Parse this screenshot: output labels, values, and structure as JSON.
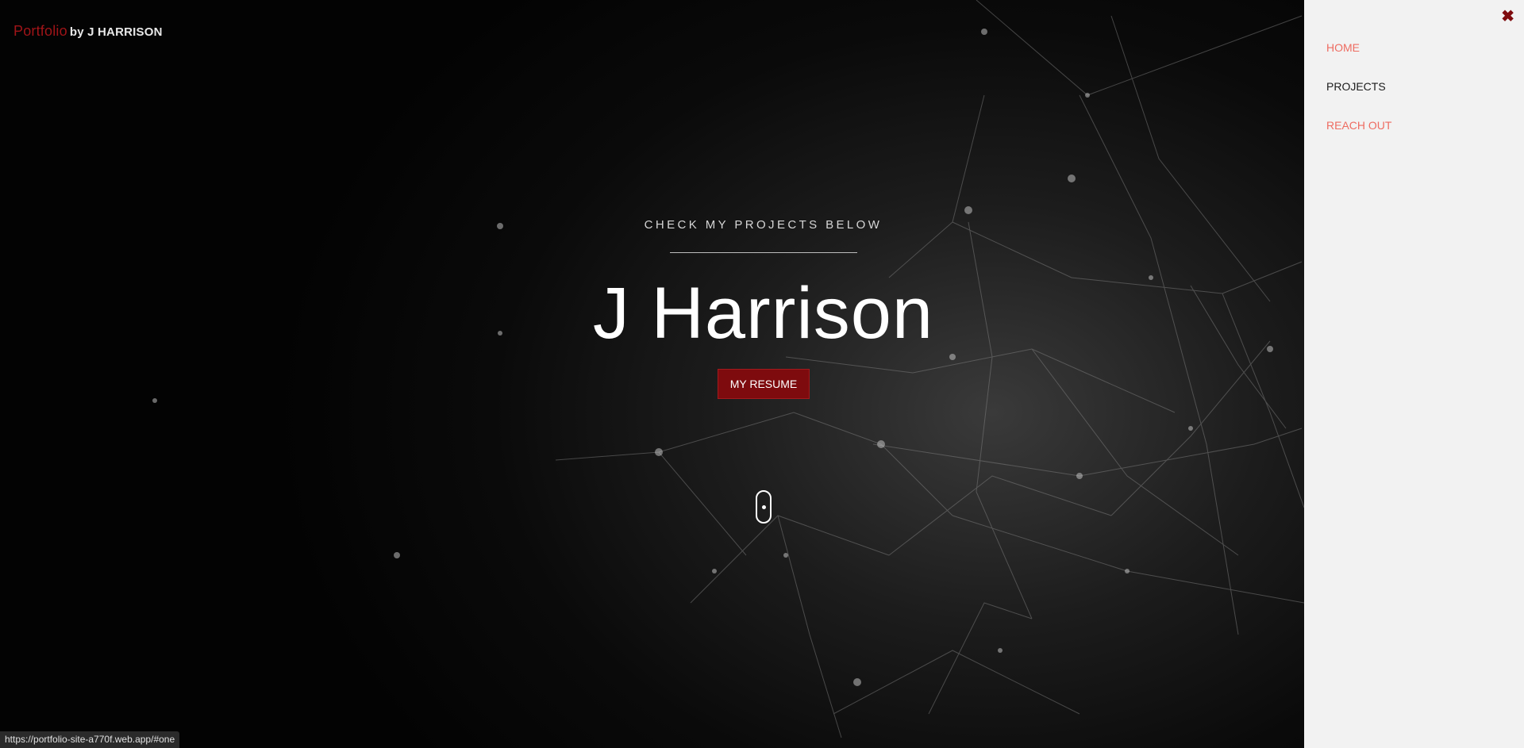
{
  "brand": {
    "word": "Portfolio",
    "byline": "by J HARRISON"
  },
  "hero": {
    "tagline": "CHECK MY PROJECTS BELOW",
    "name": "J Harrison",
    "resume_label": "MY RESUME"
  },
  "panel": {
    "close_icon": "close-icon",
    "nav": [
      {
        "label": "HOME",
        "state": "active"
      },
      {
        "label": "PROJECTS",
        "state": "default"
      },
      {
        "label": "REACH OUT",
        "state": "accent"
      }
    ]
  },
  "status": {
    "url": "https://portfolio-site-a770f.web.app/#one"
  },
  "colors": {
    "brand_red": "#a01418",
    "button_red": "#7e0b0e",
    "nav_accent": "#ee6c61",
    "panel_bg": "#f2f2f2"
  }
}
